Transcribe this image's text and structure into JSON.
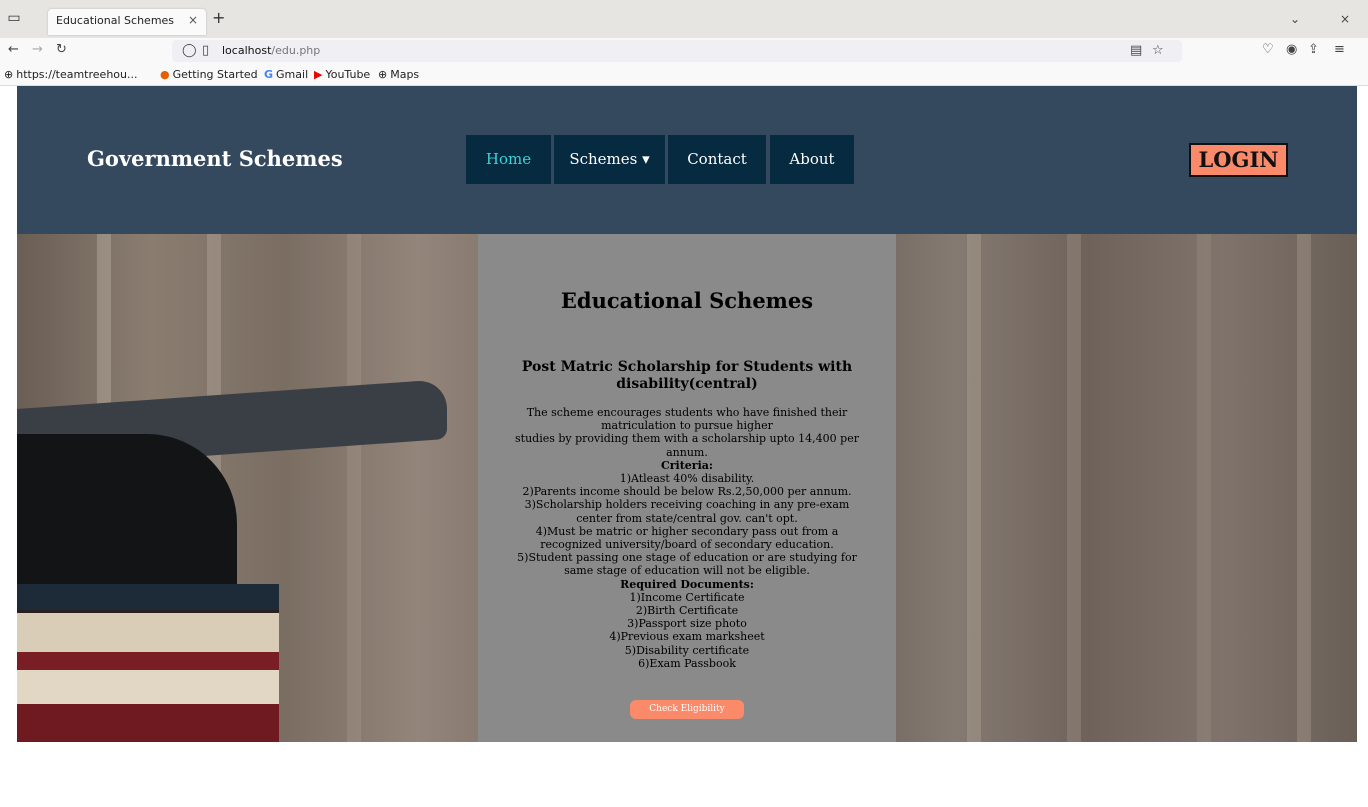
{
  "browser": {
    "tab_title": "Educational Schemes",
    "tab_close": "×",
    "new_tab": "+",
    "url_host": "localhost",
    "url_path": "/edu.php",
    "bookmarks": [
      {
        "label": "https://teamtreehou...",
        "icon": "globe-icon"
      },
      {
        "label": "Getting Started",
        "icon": "firefox-icon"
      },
      {
        "label": "Gmail",
        "icon": "google-icon"
      },
      {
        "label": "YouTube",
        "icon": "youtube-icon"
      },
      {
        "label": "Maps",
        "icon": "globe-icon"
      }
    ]
  },
  "header": {
    "brand": "Government Schemes",
    "nav": [
      {
        "label": "Home",
        "active": true
      },
      {
        "label": "Schemes ▾",
        "active": false
      },
      {
        "label": "Contact",
        "active": false
      },
      {
        "label": "About",
        "active": false
      }
    ],
    "login": "LOGIN"
  },
  "card": {
    "title": "Educational Schemes",
    "scheme_title": "Post Matric Scholarship for Students with disability(central)",
    "description_lines": [
      "The scheme encourages students who have finished their matriculation to pursue higher",
      "studies by providing them with a scholarship upto 14,400 per annum."
    ],
    "criteria_heading": "Criteria:",
    "criteria": [
      "1)Atleast 40% disability.",
      "2)Parents income should be below Rs.2,50,000 per annum.",
      "3)Scholarship holders receiving coaching in any pre-exam center from state/central gov. can't opt.",
      "4)Must be matric or higher secondary pass out from a recognized university/board of secondary education.",
      "5)Student passing one stage of education or are studying for same stage of education will not be eligible."
    ],
    "documents_heading": "Required Documents:",
    "documents": [
      "1)Income Certificate",
      "2)Birth Certificate",
      "3)Passport size photo",
      "4)Previous exam marksheet",
      "5)Disability certificate",
      "6)Exam Passbook"
    ],
    "button": "Check Eligibility"
  },
  "colors": {
    "header_bg": "#34495e",
    "nav_bg": "#062a3f",
    "nav_active": "#3fd2d8",
    "accent": "#fa8a69",
    "card_bg": "#8a8a8a"
  }
}
